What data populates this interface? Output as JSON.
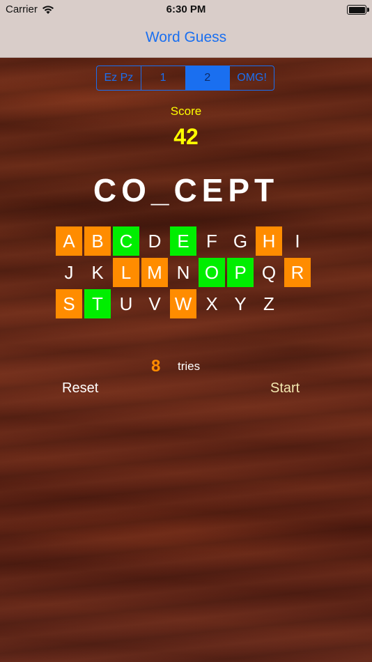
{
  "status_bar": {
    "carrier": "Carrier",
    "time": "6:30 PM",
    "wifi_icon": "wifi-icon",
    "battery_icon": "battery-icon"
  },
  "nav": {
    "title": "Word Guess"
  },
  "difficulty": {
    "options": [
      "Ez Pz",
      "1",
      "2",
      "OMG!"
    ],
    "selected": "2"
  },
  "score": {
    "label": "Score",
    "value": "42"
  },
  "word": {
    "display": "CO_CEPT"
  },
  "letters": [
    {
      "char": "A",
      "state": "wrong"
    },
    {
      "char": "B",
      "state": "wrong"
    },
    {
      "char": "C",
      "state": "right"
    },
    {
      "char": "D",
      "state": "unused"
    },
    {
      "char": "E",
      "state": "right"
    },
    {
      "char": "F",
      "state": "unused"
    },
    {
      "char": "G",
      "state": "unused"
    },
    {
      "char": "H",
      "state": "wrong"
    },
    {
      "char": "I",
      "state": "unused"
    },
    {
      "char": "J",
      "state": "unused"
    },
    {
      "char": "K",
      "state": "unused"
    },
    {
      "char": "L",
      "state": "wrong"
    },
    {
      "char": "M",
      "state": "wrong"
    },
    {
      "char": "N",
      "state": "unused"
    },
    {
      "char": "O",
      "state": "right"
    },
    {
      "char": "P",
      "state": "right"
    },
    {
      "char": "Q",
      "state": "unused"
    },
    {
      "char": "R",
      "state": "wrong"
    },
    {
      "char": "S",
      "state": "wrong"
    },
    {
      "char": "T",
      "state": "right"
    },
    {
      "char": "U",
      "state": "unused"
    },
    {
      "char": "V",
      "state": "unused"
    },
    {
      "char": "W",
      "state": "wrong"
    },
    {
      "char": "X",
      "state": "unused"
    },
    {
      "char": "Y",
      "state": "unused"
    },
    {
      "char": "Z",
      "state": "unused"
    }
  ],
  "tries": {
    "count": "8",
    "label": "tries"
  },
  "actions": {
    "reset_label": "Reset",
    "start_label": "Start"
  },
  "colors": {
    "accent": "#1a6ff0",
    "score": "#ffff00",
    "wrong": "#ff8c00",
    "right": "#00ee00"
  }
}
